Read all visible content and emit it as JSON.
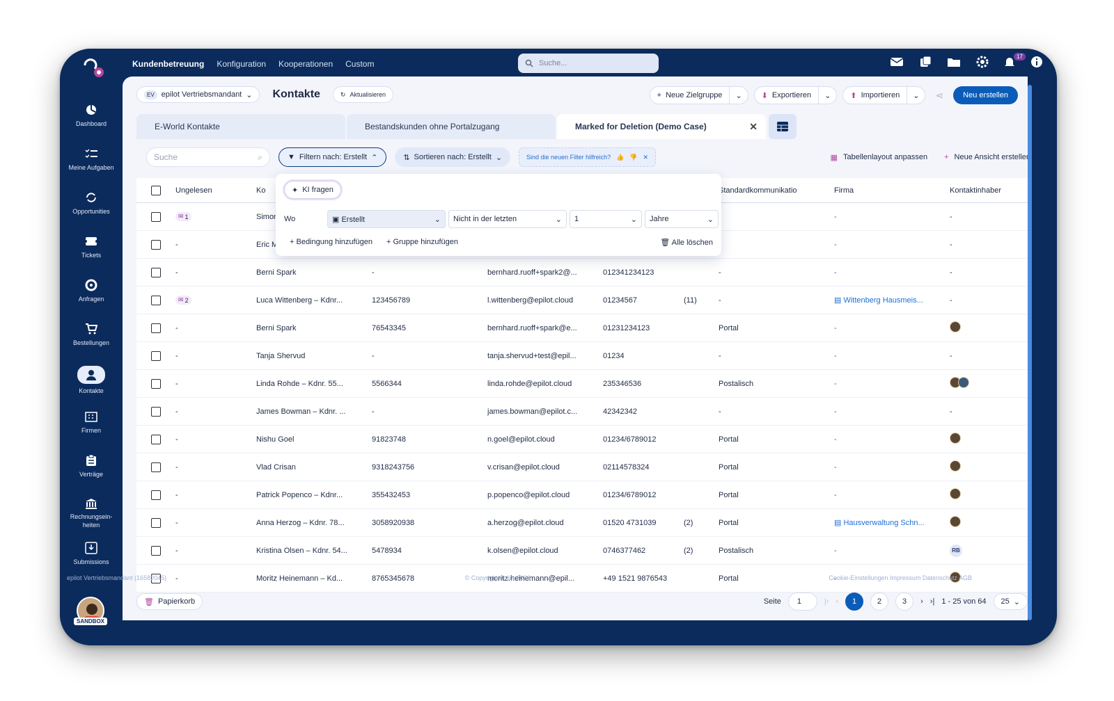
{
  "topnav": {
    "items": [
      "Kundenbetreuung",
      "Konfiguration",
      "Kooperationen",
      "Custom"
    ],
    "search_placeholder": "Suche...",
    "notif_count": "17"
  },
  "sidebar": {
    "items": [
      {
        "label": "Dashboard",
        "icon": "pie-chart-icon"
      },
      {
        "label": "Meine Aufgaben",
        "icon": "task-list-icon"
      },
      {
        "label": "Opportunities",
        "icon": "cycle-icon"
      },
      {
        "label": "Tickets",
        "icon": "ticket-icon"
      },
      {
        "label": "Anfragen",
        "icon": "lifebuoy-icon"
      },
      {
        "label": "Bestellungen",
        "icon": "cart-icon"
      },
      {
        "label": "Kontakte",
        "icon": "person-icon"
      },
      {
        "label": "Firmen",
        "icon": "building-icon"
      },
      {
        "label": "Verträge",
        "icon": "clipboard-icon"
      },
      {
        "label": "Rechnungsein-heiten",
        "icon": "bank-icon"
      },
      {
        "label": "Submissions",
        "icon": "inbox-icon"
      }
    ],
    "sandbox": "SANDBOX"
  },
  "header": {
    "tenant_short": "EV",
    "tenant": "epilot Vertriebsmandant",
    "title": "Kontakte",
    "refresh": "Aktualisieren",
    "new_group": "Neue Zielgruppe",
    "export": "Exportieren",
    "import": "Importieren",
    "create": "Neu erstellen"
  },
  "tabs": [
    "E-World Kontakte",
    "Bestandskunden ohne Portalzugang",
    "Marked for Deletion (Demo Case)"
  ],
  "toolbar": {
    "search": "Suche",
    "filter": "Filtern nach: Erstellt",
    "sort": "Sortieren nach: Erstellt",
    "feedback": "Sind die neuen Filter hilfreich?",
    "layout": "Tabellenlayout anpassen",
    "new_view": "Neue Ansicht erstellen"
  },
  "filter_popup": {
    "ki": "KI fragen",
    "wo": "Wo",
    "field": "Erstellt",
    "op": "Nicht in der letzten",
    "num": "1",
    "unit": "Jahre",
    "add_condition": "Bedingung hinzufügen",
    "add_group": "Gruppe hinzufügen",
    "clear": "Alle löschen"
  },
  "table": {
    "headers": [
      "Ungelesen",
      "Ko",
      "",
      "",
      "",
      "",
      "Standardkommunikatio",
      "Firma",
      "Kontaktinhaber"
    ],
    "rows": [
      {
        "unread": "1",
        "name": "Simon",
        "num": "",
        "email": "",
        "phone": "",
        "cnt": "",
        "comm": "",
        "firm": "-",
        "owner": "-",
        "mail": true
      },
      {
        "unread": "-",
        "name": "Eric M",
        "num": "",
        "email": "",
        "phone": "",
        "cnt": "",
        "comm": "",
        "firm": "-",
        "owner": "-"
      },
      {
        "unread": "-",
        "name": "Berni Spark",
        "num": "-",
        "email": "bernhard.ruoff+spark2@...",
        "phone": "012341234123",
        "cnt": "",
        "comm": "-",
        "firm": "-",
        "owner": "-"
      },
      {
        "unread": "2",
        "name": "Luca Wittenberg – Kdnr...",
        "num": "123456789",
        "email": "l.wittenberg@epilot.cloud",
        "phone": "01234567",
        "cnt": "(11)",
        "comm": "-",
        "firm": "Wittenberg Hausmeis...",
        "owner": "-",
        "mail": true
      },
      {
        "unread": "-",
        "name": "Berni Spark",
        "num": "76543345",
        "email": "bernhard.ruoff+spark@e...",
        "phone": "01231234123",
        "cnt": "",
        "comm": "Portal",
        "firm": "-",
        "owner": "p"
      },
      {
        "unread": "-",
        "name": "Tanja Shervud",
        "num": "-",
        "email": "tanja.shervud+test@epil...",
        "phone": "01234",
        "cnt": "",
        "comm": "-",
        "firm": "-",
        "owner": "-"
      },
      {
        "unread": "-",
        "name": "Linda Rohde – Kdnr. 55...",
        "num": "5566344",
        "email": "linda.rohde@epilot.cloud",
        "phone": "235346536",
        "cnt": "",
        "comm": "Postalisch",
        "firm": "-",
        "owner": "pp"
      },
      {
        "unread": "-",
        "name": "James Bowman – Kdnr. ...",
        "num": "-",
        "email": "james.bowman@epilot.c...",
        "phone": "42342342",
        "cnt": "",
        "comm": "-",
        "firm": "-",
        "owner": "-"
      },
      {
        "unread": "-",
        "name": "Nishu Goel",
        "num": "91823748",
        "email": "n.goel@epilot.cloud",
        "phone": "01234/6789012",
        "cnt": "",
        "comm": "Portal",
        "firm": "-",
        "owner": "p"
      },
      {
        "unread": "-",
        "name": "Vlad Crisan",
        "num": "9318243756",
        "email": "v.crisan@epilot.cloud",
        "phone": "02114578324",
        "cnt": "",
        "comm": "Portal",
        "firm": "-",
        "owner": "p"
      },
      {
        "unread": "-",
        "name": "Patrick Popenco – Kdnr...",
        "num": "355432453",
        "email": "p.popenco@epilot.cloud",
        "phone": "01234/6789012",
        "cnt": "",
        "comm": "Portal",
        "firm": "-",
        "owner": "p"
      },
      {
        "unread": "-",
        "name": "Anna Herzog – Kdnr. 78...",
        "num": "3058920938",
        "email": "a.herzog@epilot.cloud",
        "phone": "01520 4731039",
        "cnt": "(2)",
        "comm": "Portal",
        "firm": "Hausverwaltung Schn...",
        "owner": "p"
      },
      {
        "unread": "-",
        "name": "Kristina Olsen – Kdnr. 54...",
        "num": "5478934",
        "email": "k.olsen@epilot.cloud",
        "phone": "0746377462",
        "cnt": "(2)",
        "comm": "Postalisch",
        "firm": "-",
        "owner": "RB"
      },
      {
        "unread": "-",
        "name": "Moritz Heinemann – Kd...",
        "num": "8765345678",
        "email": "moritz.heinemann@epil...",
        "phone": "+49 1521 9876543",
        "cnt": "",
        "comm": "Portal",
        "firm": "-",
        "owner": "p"
      }
    ]
  },
  "pager": {
    "trash": "Papierkorb",
    "page_label": "Seite",
    "page": "1",
    "pages": [
      "1",
      "2",
      "3"
    ],
    "range": "1 - 25 von 64",
    "size": "25"
  },
  "footer": {
    "left": "epilot Vertriebsmandant (16582045)",
    "center": "© Copyright epilot 2026",
    "right": "Cookie-Einstellungen  Impressum  Datenschutz  AGB"
  }
}
